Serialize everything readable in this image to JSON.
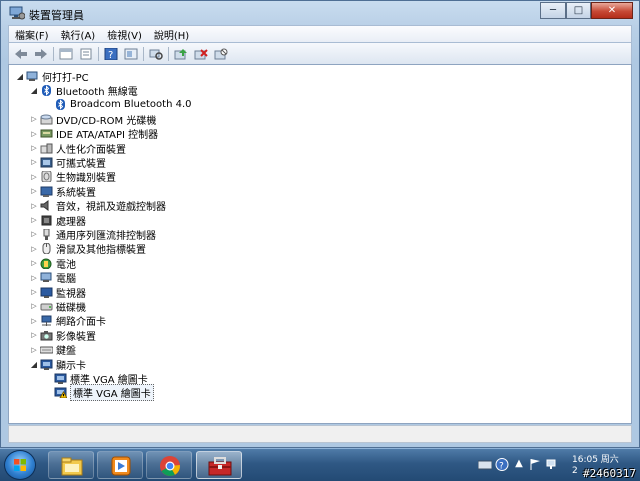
{
  "window": {
    "title": "裝置管理員",
    "caption_buttons": {
      "minimize": "─",
      "maximize": "□",
      "close": "✕"
    }
  },
  "menu": [
    "檔案(F)",
    "執行(A)",
    "檢視(V)",
    "說明(H)"
  ],
  "toolbar": [
    "back-icon",
    "forward-icon",
    "properties-panel-icon",
    "list-icon",
    "help-icon",
    "view-icon",
    "scan-hardware-icon",
    "update-driver-icon",
    "uninstall-icon",
    "disable-icon"
  ],
  "tree": [
    {
      "label": "何打打-PC",
      "level": 0,
      "expand": "open",
      "icon": "computer-icon"
    },
    {
      "label": "Bluetooth 無線電",
      "level": 1,
      "expand": "open",
      "icon": "bluetooth-icon"
    },
    {
      "label": "Broadcom Bluetooth 4.0",
      "level": 2,
      "expand": "none",
      "icon": "bluetooth-icon"
    },
    {
      "label": "DVD/CD-ROM 光碟機",
      "level": 1,
      "expand": "closed",
      "icon": "dvd-drive-icon"
    },
    {
      "label": "IDE ATA/ATAPI 控制器",
      "level": 1,
      "expand": "closed",
      "icon": "ide-controller-icon"
    },
    {
      "label": "人性化介面裝置",
      "level": 1,
      "expand": "closed",
      "icon": "hid-icon"
    },
    {
      "label": "可攜式裝置",
      "level": 1,
      "expand": "closed",
      "icon": "portable-device-icon"
    },
    {
      "label": "生物識別裝置",
      "level": 1,
      "expand": "closed",
      "icon": "biometric-icon"
    },
    {
      "label": "系統裝置",
      "level": 1,
      "expand": "closed",
      "icon": "system-device-icon"
    },
    {
      "label": "音效，視訊及遊戲控制器",
      "level": 1,
      "expand": "closed",
      "icon": "sound-icon"
    },
    {
      "label": "處理器",
      "level": 1,
      "expand": "closed",
      "icon": "processor-icon"
    },
    {
      "label": "通用序列匯流排控制器",
      "level": 1,
      "expand": "closed",
      "icon": "usb-icon"
    },
    {
      "label": "滑鼠及其他指標裝置",
      "level": 1,
      "expand": "closed",
      "icon": "mouse-icon"
    },
    {
      "label": "電池",
      "level": 1,
      "expand": "closed",
      "icon": "battery-icon"
    },
    {
      "label": "電腦",
      "level": 1,
      "expand": "closed",
      "icon": "computer-icon"
    },
    {
      "label": "監視器",
      "level": 1,
      "expand": "closed",
      "icon": "monitor-icon"
    },
    {
      "label": "磁碟機",
      "level": 1,
      "expand": "closed",
      "icon": "disk-drive-icon"
    },
    {
      "label": "網路介面卡",
      "level": 1,
      "expand": "closed",
      "icon": "network-adapter-icon"
    },
    {
      "label": "影像裝置",
      "level": 1,
      "expand": "closed",
      "icon": "imaging-device-icon"
    },
    {
      "label": "鍵盤",
      "level": 1,
      "expand": "closed",
      "icon": "keyboard-icon"
    },
    {
      "label": "顯示卡",
      "level": 1,
      "expand": "open",
      "icon": "display-adapter-icon"
    },
    {
      "label": "標準 VGA 繪圖卡",
      "level": 2,
      "expand": "none",
      "icon": "display-adapter-icon"
    },
    {
      "label": "標準 VGA 繪圖卡",
      "level": 2,
      "expand": "none",
      "icon": "display-adapter-warning-icon",
      "selected": true
    }
  ],
  "taskbar": {
    "apps": [
      "windows-explorer-icon",
      "media-player-icon",
      "chrome-icon",
      "toolbox-icon"
    ],
    "tray_icons": [
      "keyboard-icon",
      "help-icon",
      "flag-icon",
      "network-icon",
      "volume-icon"
    ],
    "clock_time": "16:05 周六",
    "clock_date": "2"
  },
  "watermark": "#2460317",
  "colors": {
    "selection": "#eef4fb",
    "titlebar": "#c9dcef",
    "taskbar": "#2f5884"
  }
}
